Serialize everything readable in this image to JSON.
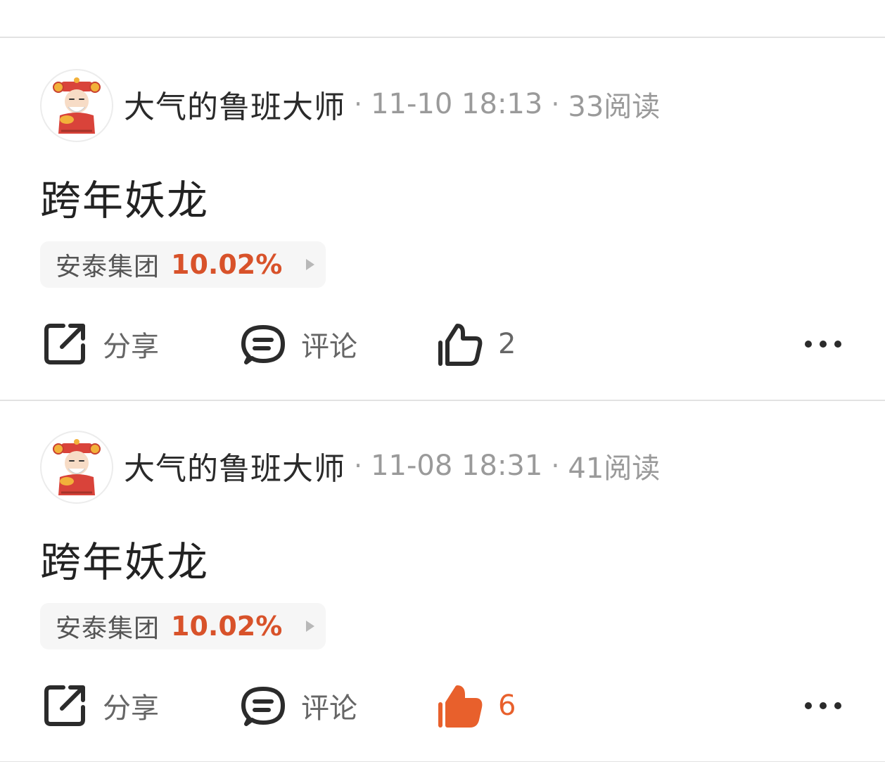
{
  "colors": {
    "accent_orange": "#e8602c",
    "stock_red": "#d8522a",
    "divider": "#e2e2e2",
    "muted_text": "#9a9a9a"
  },
  "posts": [
    {
      "author": "大气的鲁班大师",
      "date": "11-10 18:13",
      "reads": "33阅读",
      "title": "跨年妖龙",
      "stock": {
        "name": "安泰集团",
        "change": "10.02%"
      },
      "actions": {
        "share": "分享",
        "comment": "评论",
        "like_count": "2",
        "liked": false
      }
    },
    {
      "author": "大气的鲁班大师",
      "date": "11-08 18:31",
      "reads": "41阅读",
      "title": "跨年妖龙",
      "stock": {
        "name": "安泰集团",
        "change": "10.02%"
      },
      "actions": {
        "share": "分享",
        "comment": "评论",
        "like_count": "6",
        "liked": true
      }
    }
  ]
}
